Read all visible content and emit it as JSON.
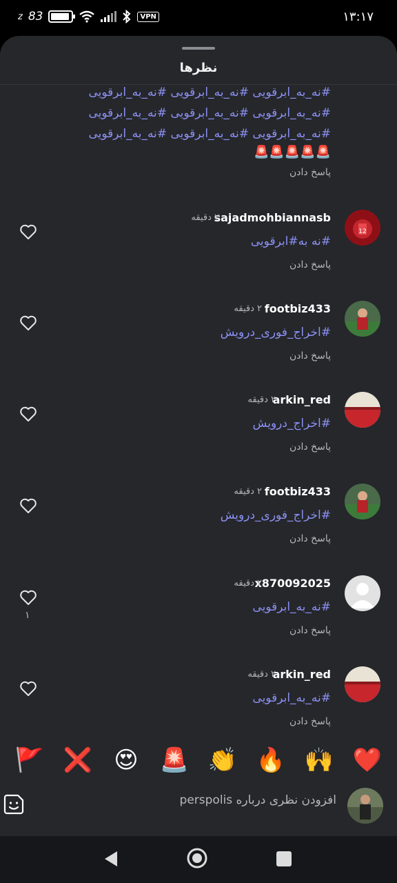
{
  "status_bar": {
    "time": "۱۳:۱۷",
    "speed": "83",
    "vpn": "VPN",
    "icons": [
      "speed-icon",
      "battery-icon",
      "wifi-icon",
      "signal-icon",
      "bluetooth-icon",
      "vpn-icon"
    ]
  },
  "sheet": {
    "title": "نظرها"
  },
  "top_comment": {
    "hashtag_lines": [
      "#نه_به_ابرقویی #نه_به_ابرقویی #نه_به_ابرقویی",
      "#نه_به_ابرقویی #نه_به_ابرقویی #نه_به_ابرقویی",
      "#نه_به_ابرقویی #نه_به_ابرقویی #نه_به_ابرقویی"
    ],
    "emojis": "🚨🚨🚨🚨🚨",
    "reply_label": "پاسخ دادن"
  },
  "comments": [
    {
      "username": "sajadmohbiannasb",
      "time": "۲ دقیقه",
      "text": "#نه به#ابرقویی",
      "reply_label": "پاسخ دادن",
      "likes": ""
    },
    {
      "username": "footbiz433",
      "time": "۲ دقیقه",
      "text": "#اخراج_فوری_درویش",
      "reply_label": "پاسخ دادن",
      "likes": ""
    },
    {
      "username": "arkin_red",
      "time": "۲ دقیقه",
      "text": "#اخراج_درویش",
      "reply_label": "پاسخ دادن",
      "likes": ""
    },
    {
      "username": "footbiz433",
      "time": "۲ دقیقه",
      "text": "#اخراج_فوری_درویش",
      "reply_label": "پاسخ دادن",
      "likes": ""
    },
    {
      "username": "x870092025",
      "time": "۲ دقیقه",
      "text": "#نه_به_ابرقویی",
      "reply_label": "پاسخ دادن",
      "likes": "۱"
    },
    {
      "username": "arkin_red",
      "time": "۲ دقیقه",
      "text": "#نه_به_ابرقویی",
      "reply_label": "پاسخ دادن",
      "likes": ""
    }
  ],
  "quick_emojis": [
    "🚩",
    "❌",
    "😍",
    "🚨",
    "👏",
    "🔥",
    "🙌",
    "❤️"
  ],
  "composer": {
    "placeholder": "افزودن نظری درباره perspolis"
  },
  "colors": {
    "sheet_bg": "#25272b",
    "hashtag": "#8c90f2",
    "muted": "#b6b8bd"
  }
}
